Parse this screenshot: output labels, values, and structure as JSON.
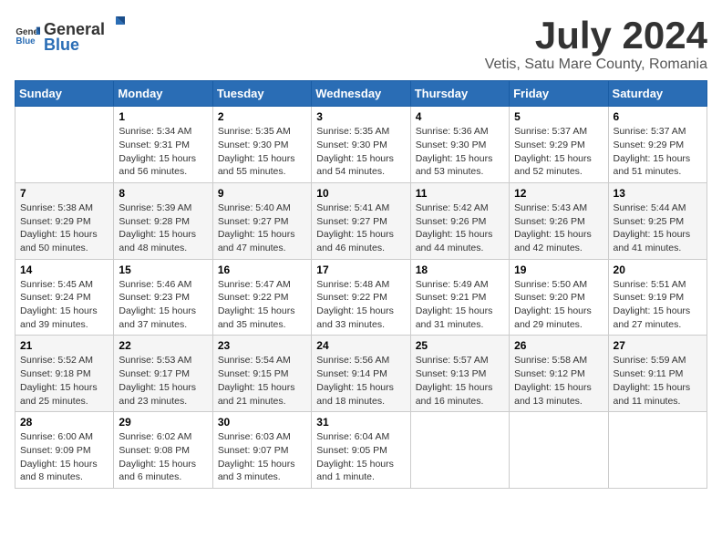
{
  "header": {
    "logo_general": "General",
    "logo_blue": "Blue",
    "month_year": "July 2024",
    "location": "Vetis, Satu Mare County, Romania"
  },
  "days_of_week": [
    "Sunday",
    "Monday",
    "Tuesday",
    "Wednesday",
    "Thursday",
    "Friday",
    "Saturday"
  ],
  "weeks": [
    [
      {
        "day": "",
        "info": ""
      },
      {
        "day": "1",
        "info": "Sunrise: 5:34 AM\nSunset: 9:31 PM\nDaylight: 15 hours\nand 56 minutes."
      },
      {
        "day": "2",
        "info": "Sunrise: 5:35 AM\nSunset: 9:30 PM\nDaylight: 15 hours\nand 55 minutes."
      },
      {
        "day": "3",
        "info": "Sunrise: 5:35 AM\nSunset: 9:30 PM\nDaylight: 15 hours\nand 54 minutes."
      },
      {
        "day": "4",
        "info": "Sunrise: 5:36 AM\nSunset: 9:30 PM\nDaylight: 15 hours\nand 53 minutes."
      },
      {
        "day": "5",
        "info": "Sunrise: 5:37 AM\nSunset: 9:29 PM\nDaylight: 15 hours\nand 52 minutes."
      },
      {
        "day": "6",
        "info": "Sunrise: 5:37 AM\nSunset: 9:29 PM\nDaylight: 15 hours\nand 51 minutes."
      }
    ],
    [
      {
        "day": "7",
        "info": "Sunrise: 5:38 AM\nSunset: 9:29 PM\nDaylight: 15 hours\nand 50 minutes."
      },
      {
        "day": "8",
        "info": "Sunrise: 5:39 AM\nSunset: 9:28 PM\nDaylight: 15 hours\nand 48 minutes."
      },
      {
        "day": "9",
        "info": "Sunrise: 5:40 AM\nSunset: 9:27 PM\nDaylight: 15 hours\nand 47 minutes."
      },
      {
        "day": "10",
        "info": "Sunrise: 5:41 AM\nSunset: 9:27 PM\nDaylight: 15 hours\nand 46 minutes."
      },
      {
        "day": "11",
        "info": "Sunrise: 5:42 AM\nSunset: 9:26 PM\nDaylight: 15 hours\nand 44 minutes."
      },
      {
        "day": "12",
        "info": "Sunrise: 5:43 AM\nSunset: 9:26 PM\nDaylight: 15 hours\nand 42 minutes."
      },
      {
        "day": "13",
        "info": "Sunrise: 5:44 AM\nSunset: 9:25 PM\nDaylight: 15 hours\nand 41 minutes."
      }
    ],
    [
      {
        "day": "14",
        "info": "Sunrise: 5:45 AM\nSunset: 9:24 PM\nDaylight: 15 hours\nand 39 minutes."
      },
      {
        "day": "15",
        "info": "Sunrise: 5:46 AM\nSunset: 9:23 PM\nDaylight: 15 hours\nand 37 minutes."
      },
      {
        "day": "16",
        "info": "Sunrise: 5:47 AM\nSunset: 9:22 PM\nDaylight: 15 hours\nand 35 minutes."
      },
      {
        "day": "17",
        "info": "Sunrise: 5:48 AM\nSunset: 9:22 PM\nDaylight: 15 hours\nand 33 minutes."
      },
      {
        "day": "18",
        "info": "Sunrise: 5:49 AM\nSunset: 9:21 PM\nDaylight: 15 hours\nand 31 minutes."
      },
      {
        "day": "19",
        "info": "Sunrise: 5:50 AM\nSunset: 9:20 PM\nDaylight: 15 hours\nand 29 minutes."
      },
      {
        "day": "20",
        "info": "Sunrise: 5:51 AM\nSunset: 9:19 PM\nDaylight: 15 hours\nand 27 minutes."
      }
    ],
    [
      {
        "day": "21",
        "info": "Sunrise: 5:52 AM\nSunset: 9:18 PM\nDaylight: 15 hours\nand 25 minutes."
      },
      {
        "day": "22",
        "info": "Sunrise: 5:53 AM\nSunset: 9:17 PM\nDaylight: 15 hours\nand 23 minutes."
      },
      {
        "day": "23",
        "info": "Sunrise: 5:54 AM\nSunset: 9:15 PM\nDaylight: 15 hours\nand 21 minutes."
      },
      {
        "day": "24",
        "info": "Sunrise: 5:56 AM\nSunset: 9:14 PM\nDaylight: 15 hours\nand 18 minutes."
      },
      {
        "day": "25",
        "info": "Sunrise: 5:57 AM\nSunset: 9:13 PM\nDaylight: 15 hours\nand 16 minutes."
      },
      {
        "day": "26",
        "info": "Sunrise: 5:58 AM\nSunset: 9:12 PM\nDaylight: 15 hours\nand 13 minutes."
      },
      {
        "day": "27",
        "info": "Sunrise: 5:59 AM\nSunset: 9:11 PM\nDaylight: 15 hours\nand 11 minutes."
      }
    ],
    [
      {
        "day": "28",
        "info": "Sunrise: 6:00 AM\nSunset: 9:09 PM\nDaylight: 15 hours\nand 8 minutes."
      },
      {
        "day": "29",
        "info": "Sunrise: 6:02 AM\nSunset: 9:08 PM\nDaylight: 15 hours\nand 6 minutes."
      },
      {
        "day": "30",
        "info": "Sunrise: 6:03 AM\nSunset: 9:07 PM\nDaylight: 15 hours\nand 3 minutes."
      },
      {
        "day": "31",
        "info": "Sunrise: 6:04 AM\nSunset: 9:05 PM\nDaylight: 15 hours\nand 1 minute."
      },
      {
        "day": "",
        "info": ""
      },
      {
        "day": "",
        "info": ""
      },
      {
        "day": "",
        "info": ""
      }
    ]
  ]
}
